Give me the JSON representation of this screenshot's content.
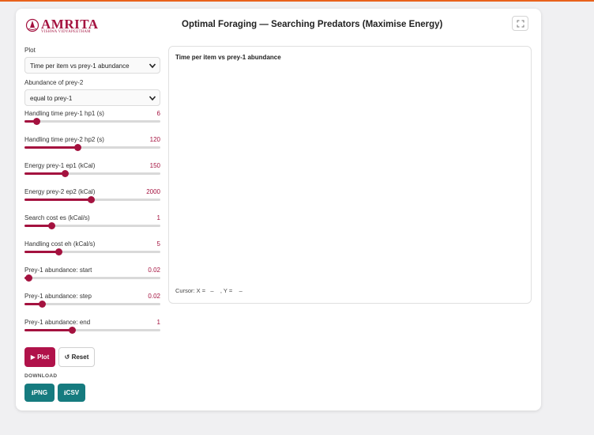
{
  "header": {
    "logo_text": "AMRITA",
    "logo_sub": "VISHWA VIDYAPEETHAM",
    "title": "Optimal Foraging — Searching Predators (Maximise Energy)",
    "fullscreen_icon": "expand-icon"
  },
  "sidebar": {
    "plot_label": "Plot",
    "plot_value": "Time per item vs prey-1 abundance",
    "abundance_label": "Abundance of prey-2",
    "abundance_value": "equal to prey-1",
    "sliders": [
      {
        "label": "Handling time prey-1 hp1 (s)",
        "value": "6",
        "fraction": 0.09
      },
      {
        "label": "Handling time prey-2 hp2 (s)",
        "value": "120",
        "fraction": 0.39
      },
      {
        "label": "Energy prey-1 ep1 (kCal)",
        "value": "150",
        "fraction": 0.3
      },
      {
        "label": "Energy prey-2 ep2 (kCal)",
        "value": "2000",
        "fraction": 0.49
      },
      {
        "label": "Search cost es (kCal/s)",
        "value": "1",
        "fraction": 0.2
      },
      {
        "label": "Handling cost eh (kCal/s)",
        "value": "5",
        "fraction": 0.25
      },
      {
        "label": "Prey-1 abundance: start",
        "value": "0.02",
        "fraction": 0.03
      },
      {
        "label": "Prey-1 abundance: step",
        "value": "0.02",
        "fraction": 0.13
      },
      {
        "label": "Prey-1 abundance: end",
        "value": "1",
        "fraction": 0.35
      }
    ]
  },
  "actions": {
    "plot_label": "▶ Plot",
    "reset_label": "↺ Reset",
    "download_label": "DOWNLOAD",
    "png_label": "⭳PNG",
    "csv_label": "⭳CSV"
  },
  "plot": {
    "title": "Time per item vs prey-1 abundance",
    "cursor": "Cursor: X =   –    , Y =    –"
  },
  "colors": {
    "accent": "#a4123f",
    "teal": "#167b7f",
    "top_bar": "#e8621c"
  }
}
